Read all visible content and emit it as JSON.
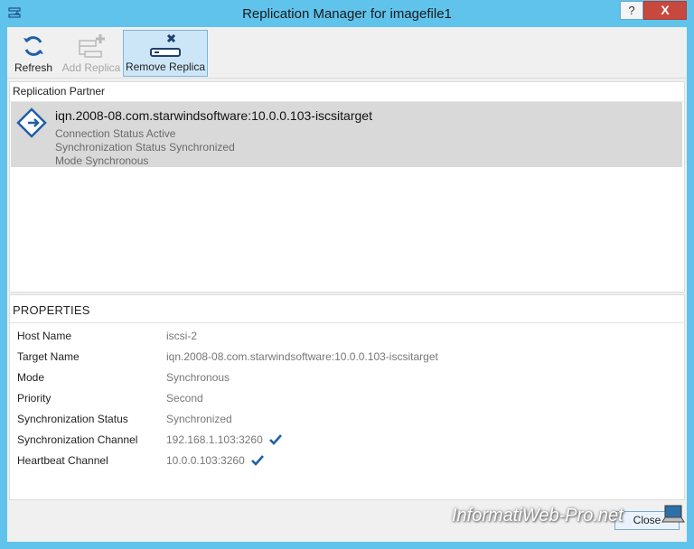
{
  "window": {
    "title": "Replication Manager for imagefile1",
    "help_label": "?",
    "close_label": "X"
  },
  "toolbar": {
    "refresh_label": "Refresh",
    "add_replica_label": "Add Replica",
    "remove_replica_label": "Remove Replica"
  },
  "partners": {
    "header": "Replication Partner",
    "items": [
      {
        "name": "iqn.2008-08.com.starwindsoftware:10.0.0.103-iscsitarget",
        "connection": "Connection Status Active",
        "sync": "Synchronization Status Synchronized",
        "mode": "Mode Synchronous"
      }
    ]
  },
  "properties": {
    "title": "PROPERTIES",
    "rows": [
      {
        "key": "Host Name",
        "value": "iscsi-2",
        "check": false
      },
      {
        "key": "Target Name",
        "value": "iqn.2008-08.com.starwindsoftware:10.0.0.103-iscsitarget",
        "check": false
      },
      {
        "key": "Mode",
        "value": "Synchronous",
        "check": false
      },
      {
        "key": "Priority",
        "value": "Second",
        "check": false
      },
      {
        "key": "Synchronization Status",
        "value": "Synchronized",
        "check": false
      },
      {
        "key": "Synchronization Channel",
        "value": "192.168.1.103:3260",
        "check": true
      },
      {
        "key": "Heartbeat Channel",
        "value": "10.0.0.103:3260",
        "check": true
      }
    ]
  },
  "footer": {
    "close_label": "Close"
  },
  "watermark": {
    "text": "InformatiWeb-Pro.net"
  },
  "colors": {
    "frame": "#5fc3ec",
    "close_button": "#c7483d",
    "selected_tool": "#cde6f7",
    "selected_row": "#d9d9d9",
    "icon_blue": "#1f5fa8"
  }
}
